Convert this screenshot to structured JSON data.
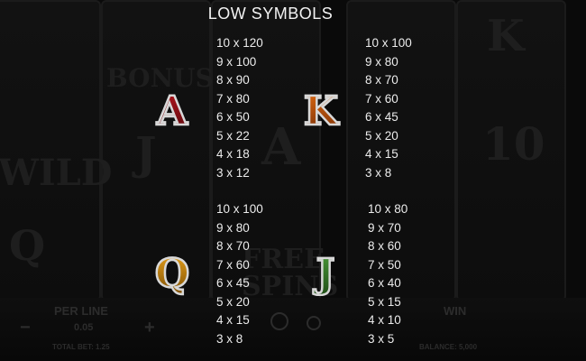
{
  "title": "LOW SYMBOLS",
  "background": {
    "ghost_labels": [
      "BONUS",
      "WILD",
      "FREE",
      "SPINS",
      "K",
      "A",
      "J",
      "10",
      "Q"
    ],
    "hud": {
      "per_line_label": "PER LINE",
      "per_line_value": "0.05",
      "total_bet": "TOTAL BET: 1.25",
      "win_label": "WIN",
      "balance": "BALANCE: 5,000",
      "minus": "−",
      "plus": "+"
    }
  },
  "groups": [
    {
      "symbol": "A",
      "colors": {
        "fill": "#b3141c",
        "dark": "#5a0a0e",
        "edge": "#d8d8d8"
      },
      "pays": [
        "10 x 120",
        "9 x 100",
        "8 x 90",
        "7 x 80",
        "6 x 50",
        "5 x 22",
        "4 x 18",
        "3 x 12"
      ]
    },
    {
      "symbol": "K",
      "colors": {
        "fill": "#e06a12",
        "dark": "#7a3006",
        "edge": "#d8d8d8"
      },
      "pays": [
        "10 x 100",
        "9 x 80",
        "8 x 70",
        "7 x 60",
        "6 x 45",
        "5 x 20",
        "4 x 15",
        "3 x 8"
      ]
    },
    {
      "symbol": "Q",
      "colors": {
        "fill": "#e8a21a",
        "dark": "#7a4d06",
        "edge": "#d8d8d8"
      },
      "pays": [
        "10 x 100",
        "9 x 80",
        "8 x 70",
        "7 x 60",
        "6 x 45",
        "5 x 20",
        "4 x 15",
        "3 x 8"
      ]
    },
    {
      "symbol": "J",
      "colors": {
        "fill": "#4c9a3a",
        "dark": "#1f4d16",
        "edge": "#d8d8d8"
      },
      "pays": [
        "10 x 80",
        "9 x 70",
        "8 x 60",
        "7 x 50",
        "6 x 40",
        "5 x 15",
        "4 x 10",
        "3 x 5"
      ]
    }
  ]
}
